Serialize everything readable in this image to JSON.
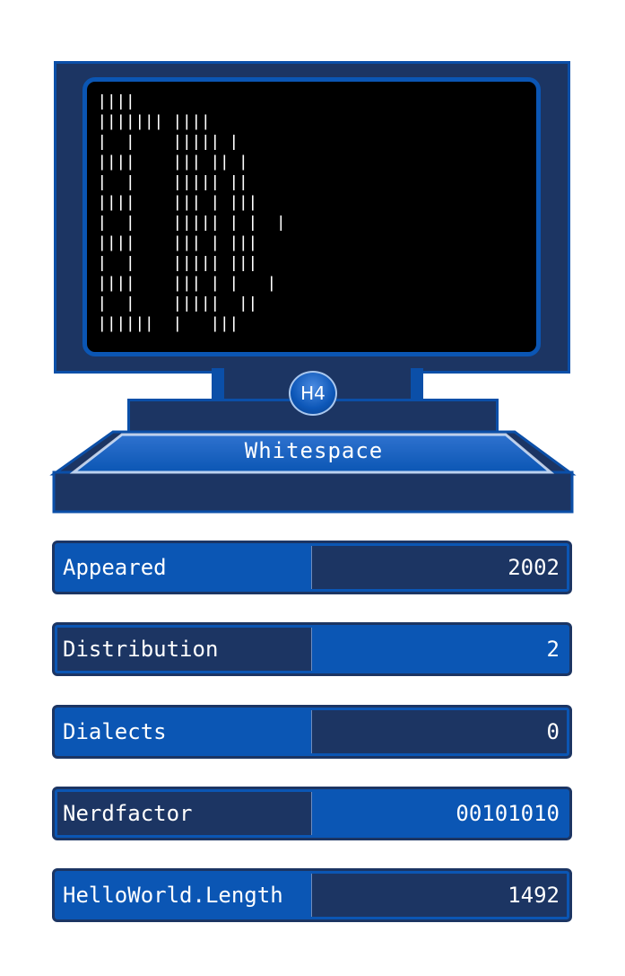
{
  "language": {
    "name": "Whitespace",
    "badge": "H4"
  },
  "stats": [
    {
      "label": "Appeared",
      "value": "2002"
    },
    {
      "label": "Distribution",
      "value": "2"
    },
    {
      "label": "Dialects",
      "value": "0"
    },
    {
      "label": "Nerdfactor",
      "value": "00101010"
    },
    {
      "label": "HelloWorld.Length",
      "value": "1492"
    }
  ],
  "colors": {
    "frame": "#1c3563",
    "accent": "#0b56b4",
    "screen": "#000000",
    "text": "#ffffff"
  }
}
